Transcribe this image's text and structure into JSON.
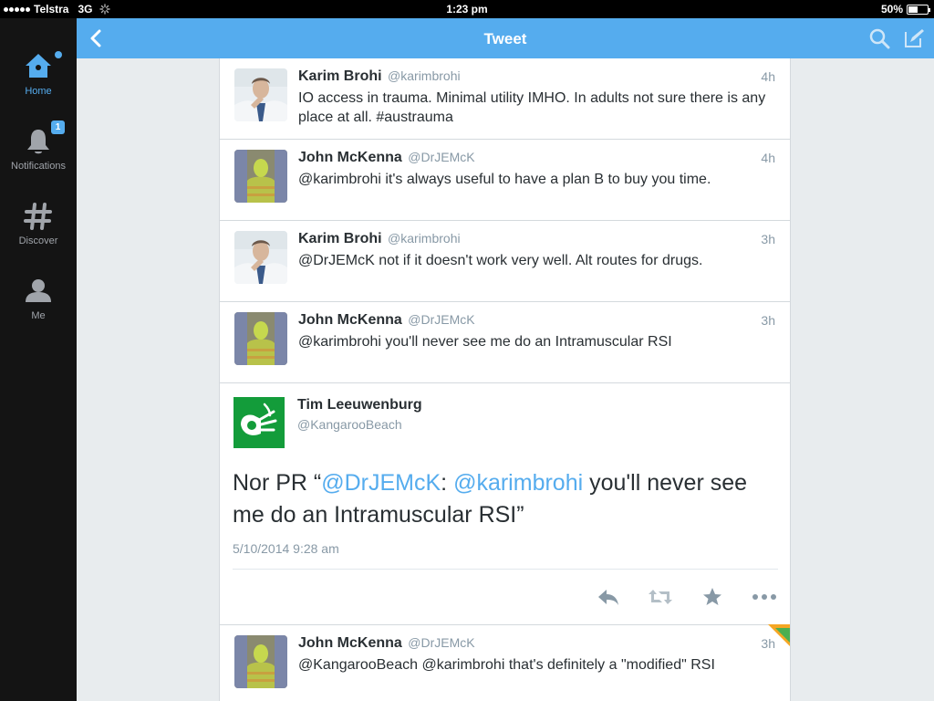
{
  "status_bar": {
    "carrier": "Telstra",
    "network": "3G",
    "time": "1:23 pm",
    "battery": "50%",
    "battery_level": 0.5
  },
  "sidebar": {
    "items": [
      {
        "label": "Home",
        "icon": "home-icon",
        "active": true
      },
      {
        "label": "Notifications",
        "icon": "bell-icon",
        "badge": "1"
      },
      {
        "label": "Discover",
        "icon": "hashtag-icon"
      },
      {
        "label": "Me",
        "icon": "person-icon"
      }
    ]
  },
  "navbar": {
    "title": "Tweet",
    "back_icon": "chevron-left-icon",
    "search_icon": "search-icon",
    "compose_icon": "compose-icon"
  },
  "colors": {
    "brand": "#55acee",
    "text": "#292f33",
    "muted": "#8899a6",
    "avatar_green": "#139c3a"
  },
  "tweets": [
    {
      "name": "Karim Brohi",
      "handle": "@karimbrohi",
      "time": "4h",
      "text": "IO access in trauma. Minimal utility IMHO. In adults not sure there is any place at all. #austrauma"
    },
    {
      "name": "John McKenna",
      "handle": "@DrJEMcK",
      "time": "4h",
      "text": "@karimbrohi it's always useful to have a plan B to buy you time."
    },
    {
      "name": "Karim Brohi",
      "handle": "@karimbrohi",
      "time": "3h",
      "text": "@DrJEMcK not if it doesn't work very well. Alt routes for drugs."
    },
    {
      "name": "John McKenna",
      "handle": "@DrJEMcK",
      "time": "3h",
      "text": "@karimbrohi you'll never see me do an Intramuscular RSI"
    }
  ],
  "detail": {
    "name": "Tim Leeuwenburg",
    "handle": "@KangarooBeach",
    "text_prefix": "Nor PR “",
    "mention1": "@DrJEMcK",
    "colon": ": ",
    "mention2": "@karimbrohi",
    "text_suffix": " you'll never see me do an Intramuscular RSI”",
    "date": "5/10/2014 9:28 am",
    "actions": [
      "reply-icon",
      "retweet-icon",
      "favorite-icon",
      "more-icon"
    ]
  },
  "reply": {
    "name": "John McKenna",
    "handle": "@DrJEMcK",
    "time": "3h",
    "text": "@KangarooBeach @karimbrohi that's definitely a \"modified\" RSI"
  }
}
